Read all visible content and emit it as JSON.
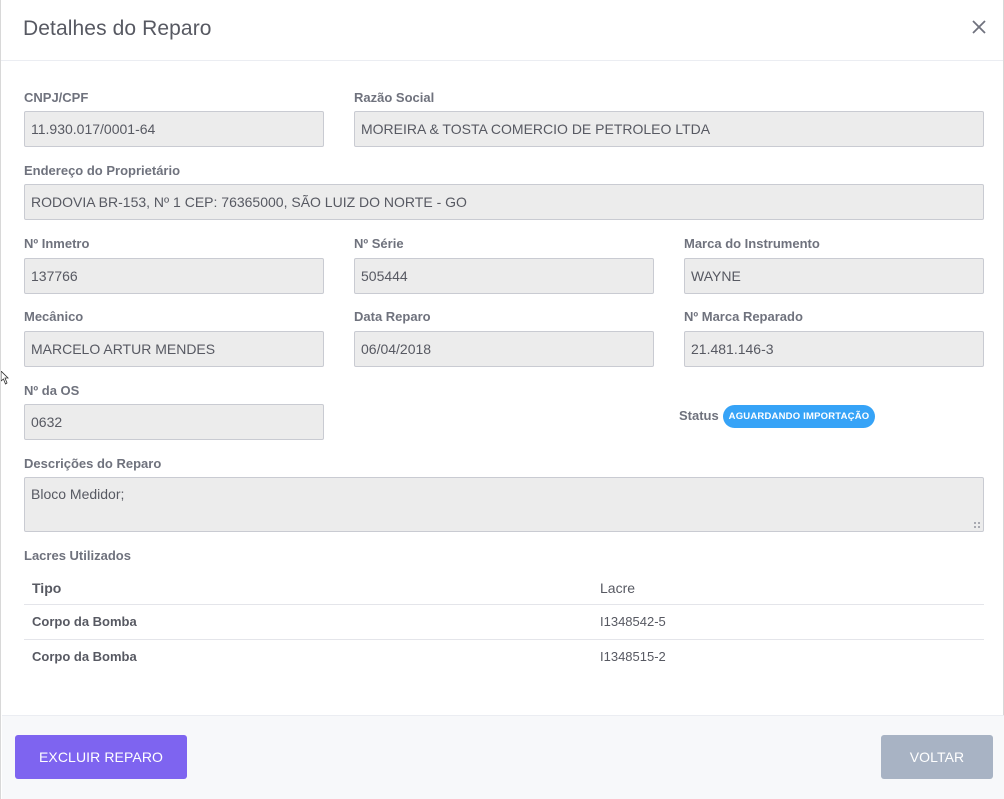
{
  "modal": {
    "title": "Detalhes do Reparo",
    "close_icon": "close-icon"
  },
  "form": {
    "cnpj": {
      "label": "CNPJ/CPF",
      "value": "11.930.017/0001-64"
    },
    "razao": {
      "label": "Razão Social",
      "value": "MOREIRA & TOSTA COMERCIO DE PETROLEO LTDA"
    },
    "endereco": {
      "label": "Endereço do Proprietário",
      "value": "RODOVIA BR-153, Nº 1 CEP: 76365000, SÃO LUIZ DO NORTE - GO"
    },
    "inmetro": {
      "label": "Nº Inmetro",
      "value": "137766"
    },
    "serie": {
      "label": "Nº Série",
      "value": "505444"
    },
    "marca_instrumento": {
      "label": "Marca do Instrumento",
      "value": "WAYNE"
    },
    "mecanico": {
      "label": "Mecânico",
      "value": "MARCELO ARTUR MENDES"
    },
    "data_reparo": {
      "label": "Data Reparo",
      "value": "06/04/2018"
    },
    "marca_reparado": {
      "label": "Nº Marca Reparado",
      "value": "21.481.146-3"
    },
    "os": {
      "label": "Nº da OS",
      "value": "0632"
    },
    "status": {
      "label": "Status",
      "value": "AGUARDANDO IMPORTAÇÃO",
      "color": "#36a3f7"
    },
    "descricoes": {
      "label": "Descrições do Reparo",
      "value": "Bloco Medidor;"
    }
  },
  "lacres": {
    "title": "Lacres Utilizados",
    "columns": [
      "Tipo",
      "Lacre"
    ],
    "rows": [
      {
        "tipo": "Corpo da Bomba",
        "lacre": "I1348542-5"
      },
      {
        "tipo": "Corpo da Bomba",
        "lacre": "I1348515-2"
      }
    ]
  },
  "footer": {
    "delete_label": "EXCLUIR REPARO",
    "back_label": "VOLTAR",
    "delete_color": "#7e64f0",
    "back_color": "#a8b3c4"
  }
}
